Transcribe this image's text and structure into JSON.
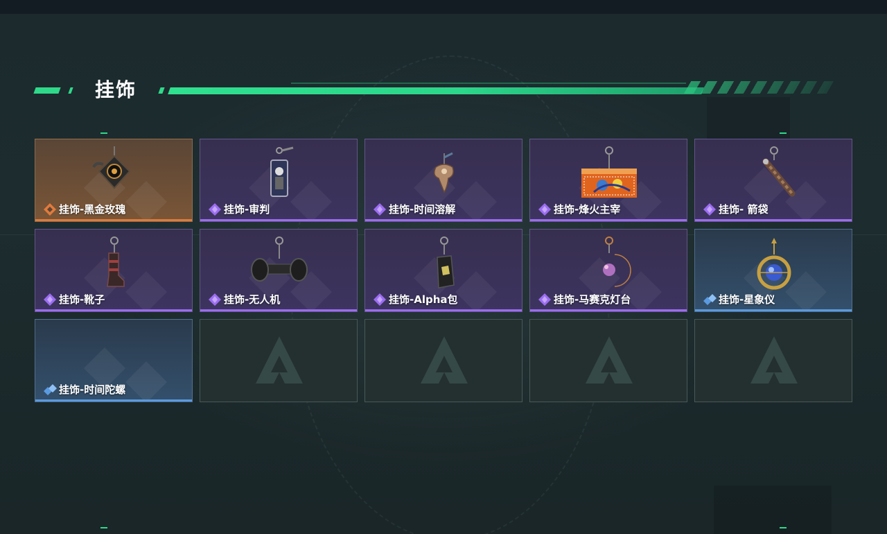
{
  "header": {
    "title": "挂饰"
  },
  "items": [
    {
      "label": "挂饰-黑金玫瑰",
      "rarity": "gold",
      "icon": "rose-pendant-icon"
    },
    {
      "label": "挂饰-审判",
      "rarity": "purple",
      "icon": "judgement-card-icon"
    },
    {
      "label": "挂饰-时间溶解",
      "rarity": "purple",
      "icon": "melting-clock-icon"
    },
    {
      "label": "挂饰-烽火主宰",
      "rarity": "purple",
      "icon": "banner-plate-icon"
    },
    {
      "label": "挂饰- 箭袋",
      "rarity": "purple",
      "icon": "quiver-icon"
    },
    {
      "label": "挂饰-靴子",
      "rarity": "purple",
      "icon": "boot-icon"
    },
    {
      "label": "挂饰-无人机",
      "rarity": "purple",
      "icon": "drone-icon"
    },
    {
      "label": "挂饰-Alpha包",
      "rarity": "purple",
      "icon": "alpha-bag-icon"
    },
    {
      "label": "挂饰-马赛克灯台",
      "rarity": "purple",
      "icon": "mosaic-lamp-icon"
    },
    {
      "label": "挂饰-星象仪",
      "rarity": "blue",
      "icon": "astrolabe-icon"
    },
    {
      "label": "挂饰-时间陀螺",
      "rarity": "blue",
      "icon": "time-top-icon"
    }
  ],
  "empty_slots": 4,
  "colors": {
    "accent": "#2fd98a",
    "gold": "#e07b3c",
    "purple": "#9b6df0",
    "blue": "#5a9ae0"
  }
}
